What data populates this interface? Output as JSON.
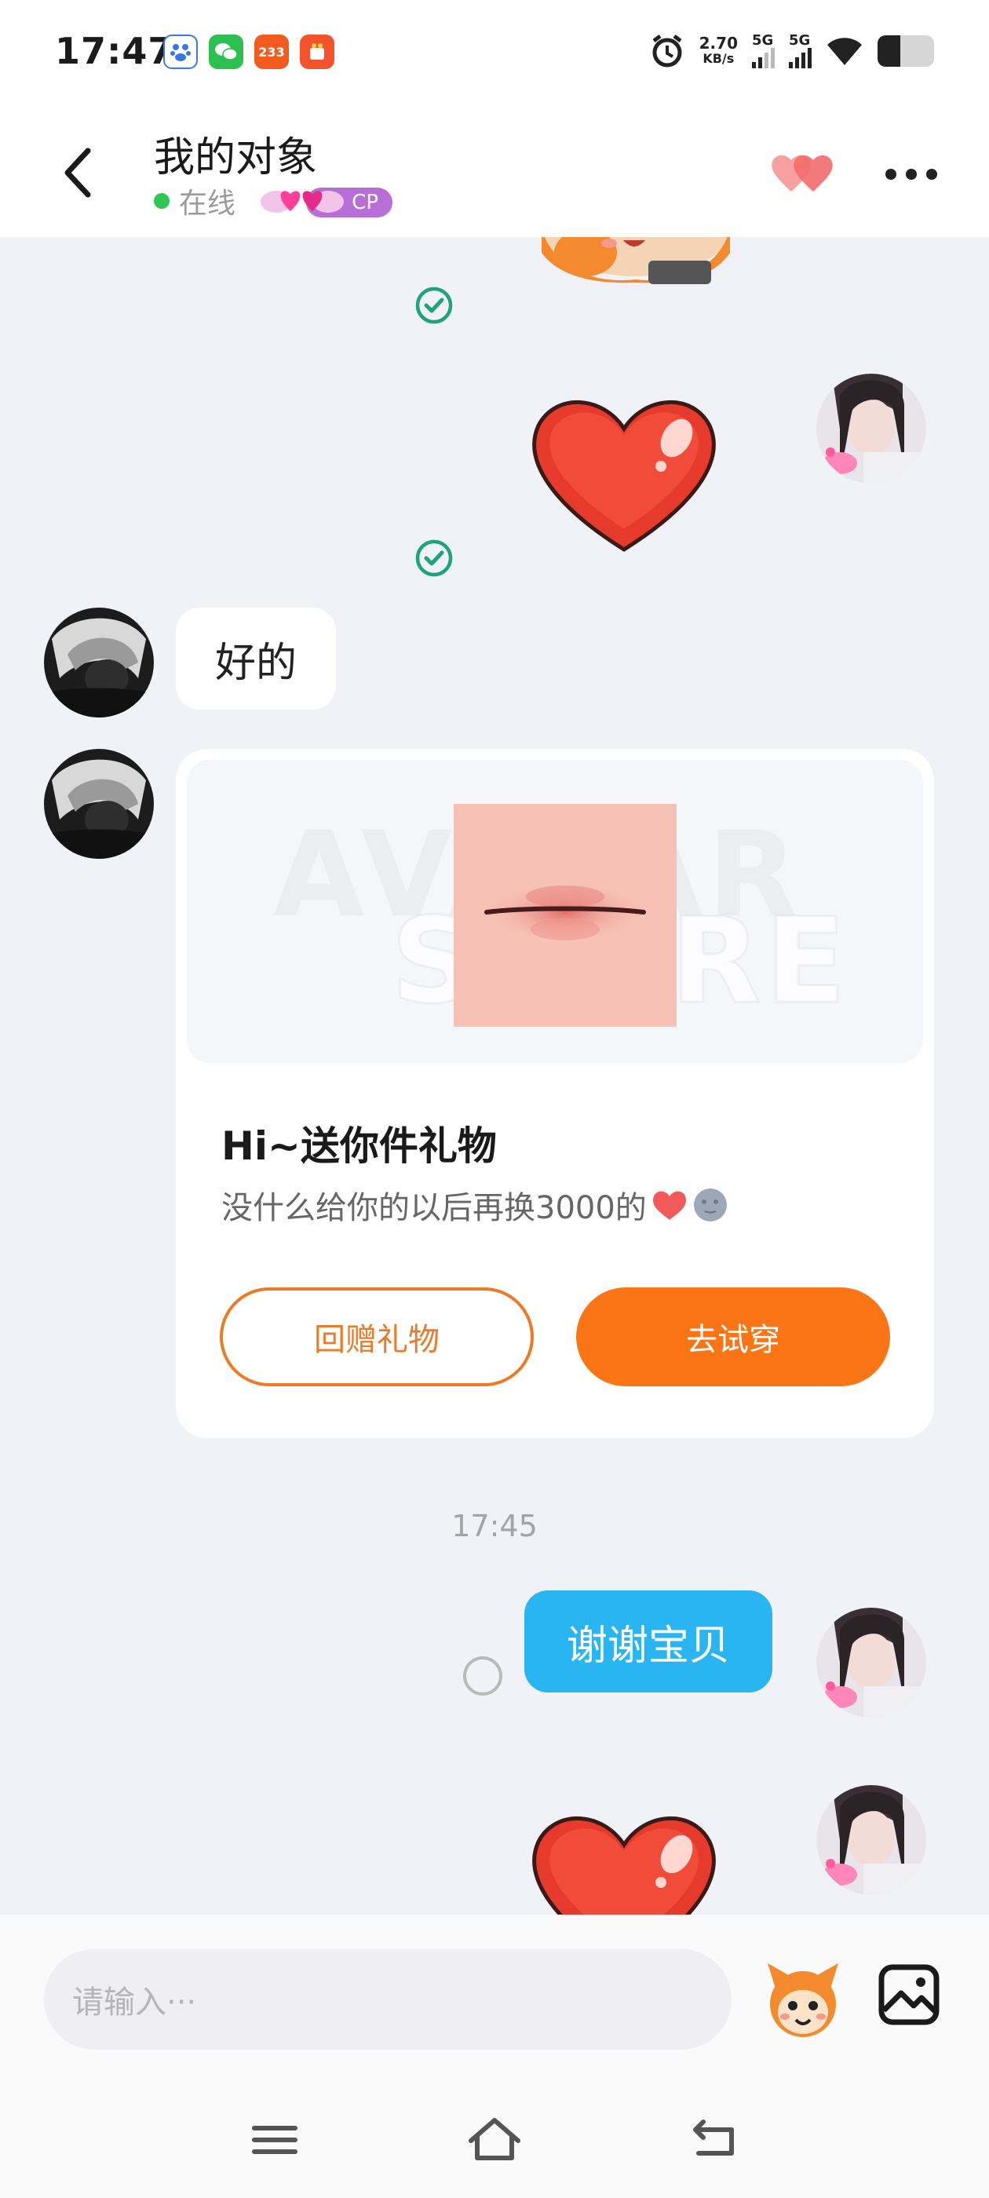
{
  "status_bar": {
    "time": "17:47",
    "net_speed_value": "2.70",
    "net_speed_unit": "KB/s",
    "sim1_label": "5G",
    "sim2_label": "5G",
    "battery_level_percent": 40,
    "app_icons": [
      "baidu-icon",
      "wechat-icon",
      "233-icon",
      "app-store-icon"
    ],
    "app_233_label": "233"
  },
  "header": {
    "title": "我的对象",
    "online_status": "在线",
    "cp_label": "CP"
  },
  "messages": {
    "reply_text": "好的",
    "gift_card": {
      "watermark_line1": "AVATAR",
      "watermark_line2": "STORE",
      "title": "Hi~送你件礼物",
      "message": "没什么给你的以后再换3000的",
      "message_emojis": [
        "❤️",
        "🌚"
      ],
      "return_gift_label": "回赠礼物",
      "try_on_label": "去试穿"
    },
    "timestamp": "17:45",
    "sent_text": "谢谢宝贝"
  },
  "input_bar": {
    "placeholder": "请输入···"
  },
  "colors": {
    "accent_orange": "#fb7517",
    "sent_bubble_blue": "#29b4f2",
    "online_green": "#31c553",
    "read_tick_green": "#1ea37a"
  }
}
